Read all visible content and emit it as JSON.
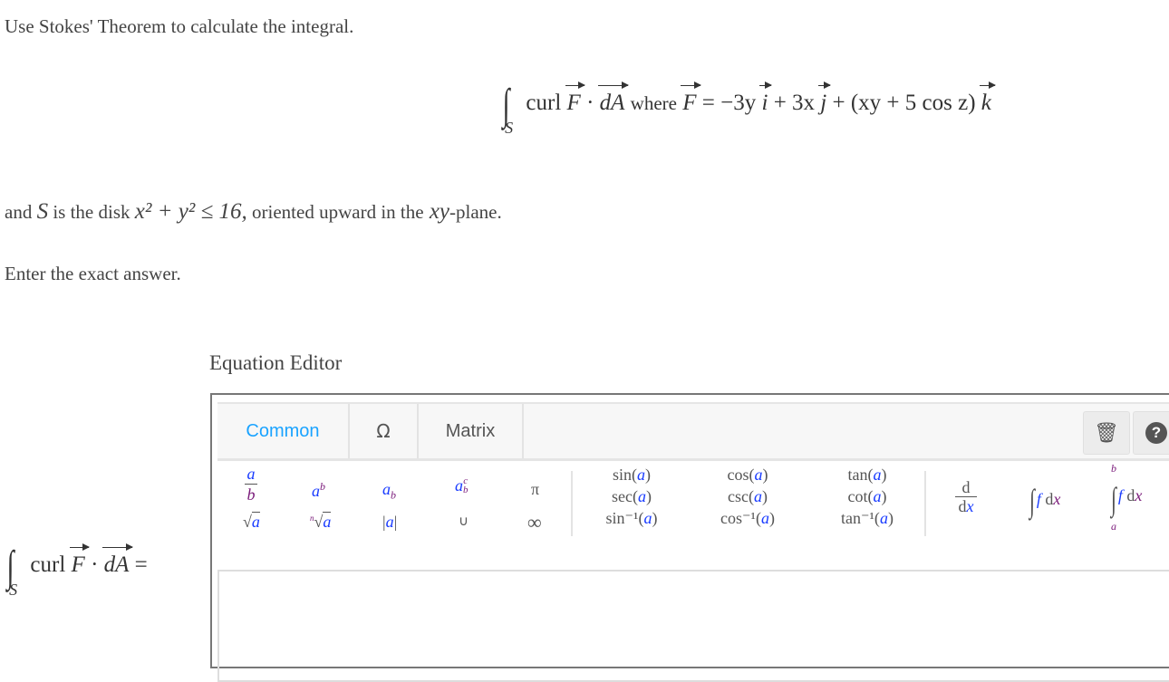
{
  "question": {
    "intro": "Use Stokes' Theorem to calculate the integral.",
    "formula": {
      "integral_sub": "S",
      "curl": "curl",
      "F": "F",
      "dot": "·",
      "dA": "dA",
      "where": "where",
      "equals": "=",
      "term1": "−3y",
      "i": "i",
      "plus1": "+ 3x",
      "j": "j",
      "plus2": "+ (xy + 5 cos z)",
      "k": "k"
    },
    "condition_prefix": "and",
    "S": "S",
    "condition_mid": "is the disk",
    "condition_math": "x² + y² ≤ 16,",
    "condition_suffix": "oriented upward in the",
    "plane": "xy",
    "plane_suffix": "-plane.",
    "instruction": "Enter the exact answer."
  },
  "editor": {
    "title": "Equation Editor",
    "tabs": [
      {
        "label": "Common",
        "active": true
      },
      {
        "label": "Ω"
      },
      {
        "label": "Matrix"
      }
    ],
    "active_color": "#1aa3ff",
    "buttons": {
      "trash": "trash-icon",
      "help": "help-icon"
    },
    "palette": {
      "pi": "π",
      "infinity": "∞",
      "union": "∪",
      "sin": "sin(",
      "sec": "sec(",
      "asin": "sin⁻¹(",
      "cos": "cos(",
      "csc": "csc(",
      "acos": "cos⁻¹(",
      "tan": "tan(",
      "cot": "cot(",
      "atan": "tan⁻¹(",
      "a": "a",
      "b": "b",
      "c": "c",
      "n": "n",
      "close": ")",
      "d": "d",
      "dx": "d",
      "x": "x",
      "f": "f"
    }
  },
  "answer_label": {
    "sub": "S",
    "curl": "curl",
    "F": "F",
    "dot": "·",
    "dA": "dA",
    "equals": "="
  },
  "answer_value": ""
}
